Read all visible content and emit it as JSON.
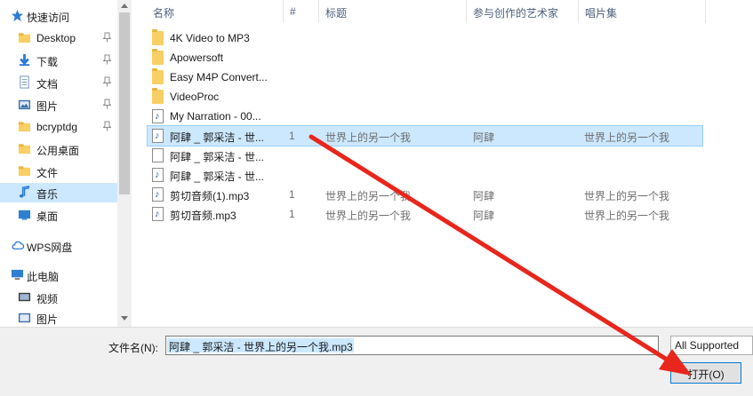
{
  "nav": {
    "quick_access": "快速访问",
    "items": [
      {
        "label": "Desktop",
        "icon": "desktop-folder-icon"
      },
      {
        "label": "下载",
        "icon": "download-icon"
      },
      {
        "label": "文档",
        "icon": "documents-icon"
      },
      {
        "label": "图片",
        "icon": "pictures-icon"
      },
      {
        "label": "bcryptdg",
        "icon": "folder-icon"
      },
      {
        "label": "公用桌面",
        "icon": "folder-icon"
      },
      {
        "label": "文件",
        "icon": "folder-icon"
      },
      {
        "label": "音乐",
        "icon": "music-icon"
      },
      {
        "label": "桌面",
        "icon": "desktop-icon"
      }
    ],
    "wps": "WPS网盘",
    "this_pc": "此电脑",
    "pc_items": [
      {
        "label": "视频",
        "icon": "video-icon"
      },
      {
        "label": "图片",
        "icon": "pictures-icon"
      }
    ]
  },
  "columns": {
    "name": "名称",
    "number": "#",
    "title": "标题",
    "artist": "参与创作的艺术家",
    "album": "唱片集"
  },
  "files": [
    {
      "name": "4K Video to MP3",
      "type": "folder",
      "number": "",
      "title": "",
      "artist": "",
      "album": ""
    },
    {
      "name": "Apowersoft",
      "type": "folder",
      "number": "",
      "title": "",
      "artist": "",
      "album": ""
    },
    {
      "name": "Easy M4P Convert...",
      "type": "folder",
      "number": "",
      "title": "",
      "artist": "",
      "album": ""
    },
    {
      "name": "VideoProc",
      "type": "folder",
      "number": "",
      "title": "",
      "artist": "",
      "album": ""
    },
    {
      "name": "My Narration - 00...",
      "type": "audio",
      "number": "",
      "title": "",
      "artist": "",
      "album": ""
    },
    {
      "name": "阿肆 _ 郭采洁 - 世...",
      "type": "audio",
      "number": "1",
      "title": "世界上的另一个我",
      "artist": "阿肆",
      "album": "世界上的另一个我"
    },
    {
      "name": "阿肆 _ 郭采洁 - 世...",
      "type": "file",
      "number": "",
      "title": "",
      "artist": "",
      "album": ""
    },
    {
      "name": "阿肆 _ 郭采洁 - 世...",
      "type": "audio",
      "number": "",
      "title": "",
      "artist": "",
      "album": ""
    },
    {
      "name": "剪切音频(1).mp3",
      "type": "audio",
      "number": "1",
      "title": "世界上的另一个我",
      "artist": "阿肆",
      "album": "世界上的另一个我"
    },
    {
      "name": "剪切音频.mp3",
      "type": "audio",
      "number": "1",
      "title": "世界上的另一个我",
      "artist": "阿肆",
      "album": "世界上的另一个我"
    }
  ],
  "bottom": {
    "filename_label": "文件名(N):",
    "filename_value": "阿肆 _ 郭采洁 - 世界上的另一个我.mp3",
    "filter_value": "All Supported",
    "open_label": "打开(O)"
  },
  "colors": {
    "selection": "#cce8ff",
    "annotation": "#e8261c",
    "accent": "#0078d7"
  }
}
